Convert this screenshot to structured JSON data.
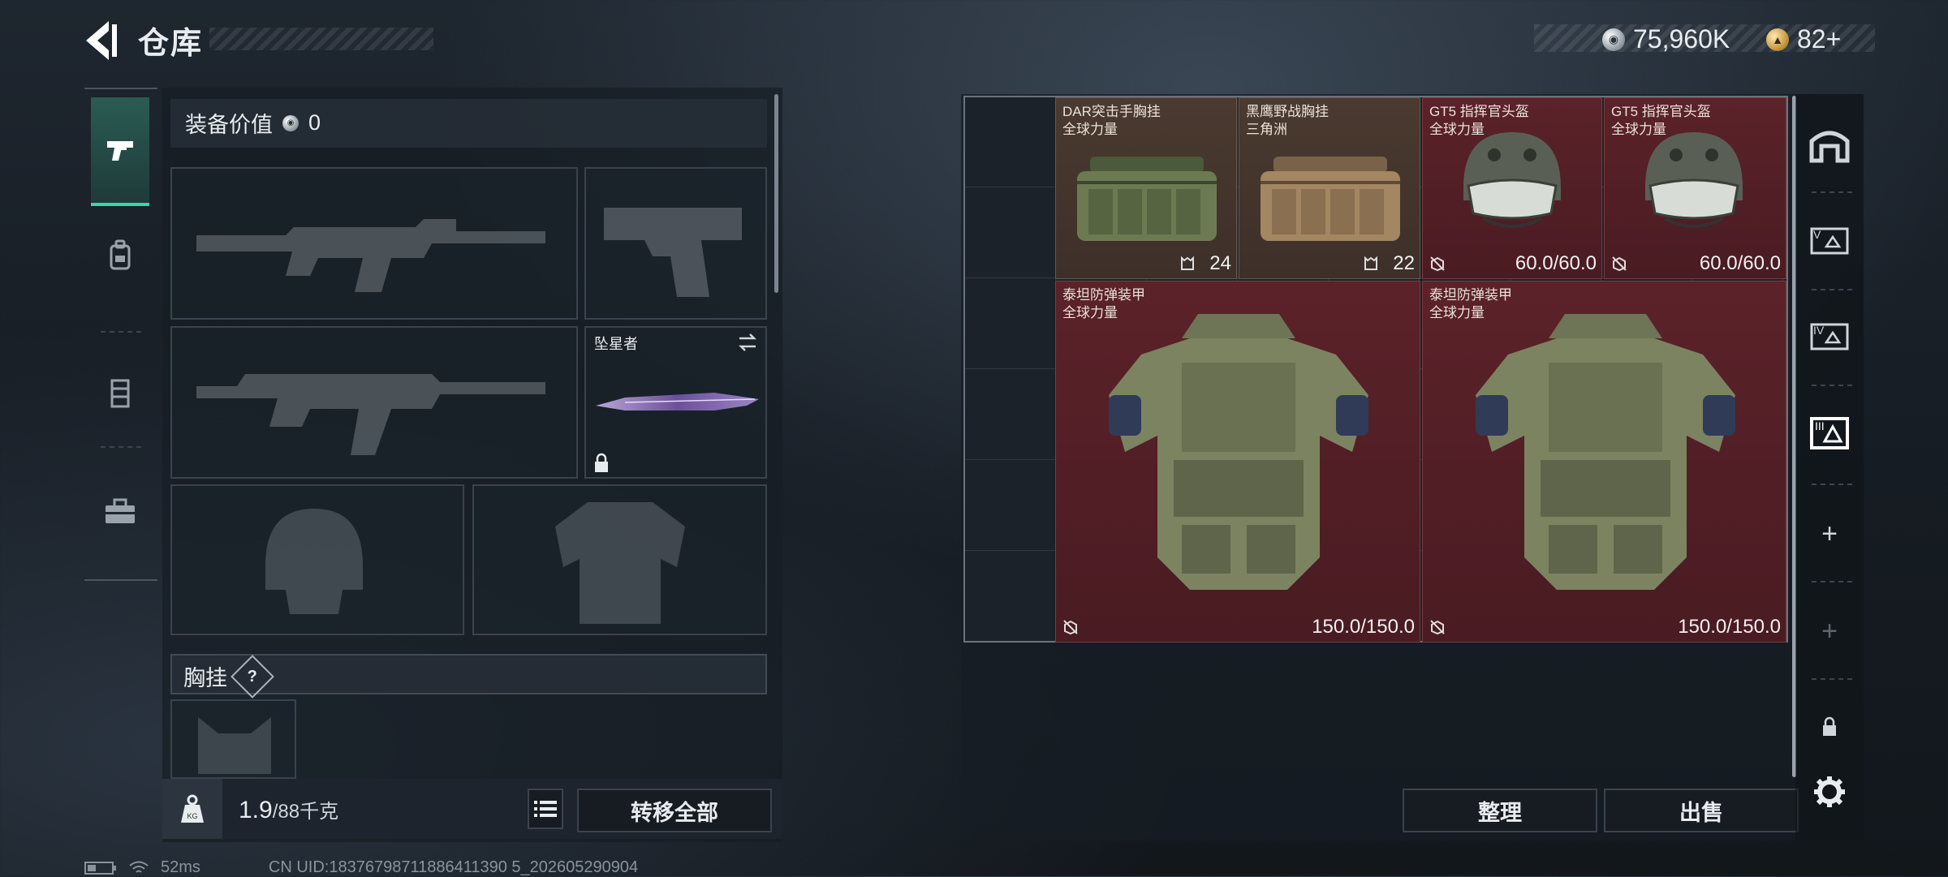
{
  "header": {
    "title": "仓库",
    "currency_silver": "75,960K",
    "currency_gold": "82+"
  },
  "equipment": {
    "value_label": "装备价值",
    "value": "0",
    "melee_name": "坠星者",
    "pocket_label": "胸挂",
    "help_label": "?"
  },
  "bottom": {
    "weight_current": "1.9",
    "weight_max": "/88千克",
    "transfer_all": "转移全部"
  },
  "stash": {
    "items": [
      {
        "name": "DAR突击手胸挂",
        "sub": "全球力量",
        "stat": "24",
        "type": "chest-rig",
        "color": "brown"
      },
      {
        "name": "黑鹰野战胸挂",
        "sub": "三角洲",
        "stat": "22",
        "type": "chest-rig",
        "color": "brown"
      },
      {
        "name": "GT5 指挥官头盔",
        "sub": "全球力量",
        "stat": "60.0/60.0",
        "type": "helmet",
        "color": "red"
      },
      {
        "name": "GT5 指挥官头盔",
        "sub": "全球力量",
        "stat": "60.0/60.0",
        "type": "helmet",
        "color": "red"
      },
      {
        "name": "泰坦防弹装甲",
        "sub": "全球力量",
        "stat": "150.0/150.0",
        "type": "armor",
        "color": "red"
      },
      {
        "name": "泰坦防弹装甲",
        "sub": "全球力量",
        "stat": "150.0/150.0",
        "type": "armor",
        "color": "red"
      }
    ],
    "sort_button": "整理",
    "sell_button": "出售"
  },
  "status": {
    "ping": "52ms",
    "uid": "CN UID:18376798711886411390 5_202605290904"
  },
  "colors": {
    "accent": "#3ad6a8",
    "item_red": "#5b2229",
    "item_brown": "#4a3a30"
  }
}
